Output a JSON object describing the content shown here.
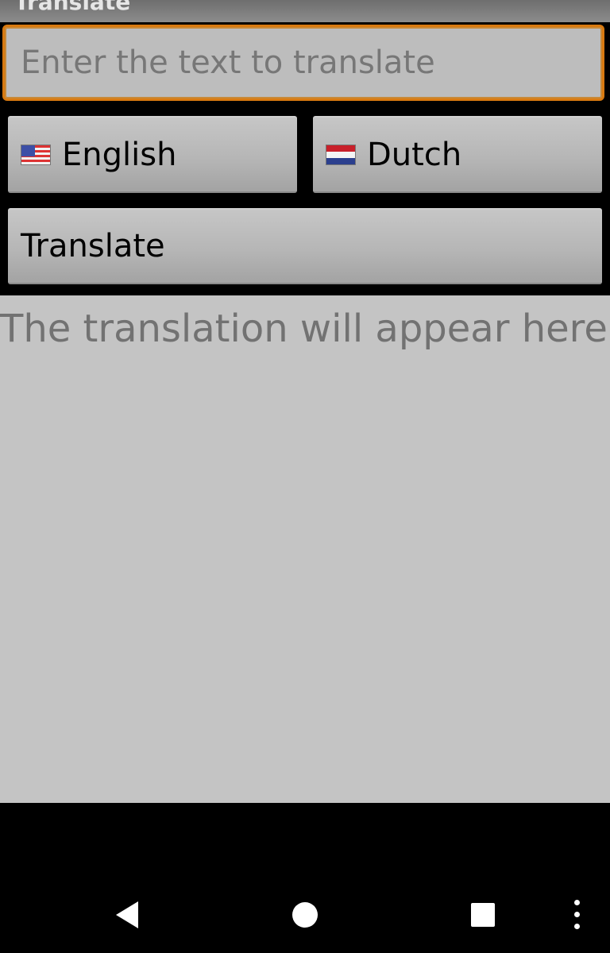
{
  "app": {
    "title": "Translate"
  },
  "input": {
    "placeholder": "Enter the text to translate",
    "value": ""
  },
  "languages": {
    "source": {
      "label": "English",
      "flag_icon": "us-flag-icon"
    },
    "target": {
      "label": "Dutch",
      "flag_icon": "netherlands-flag-icon"
    }
  },
  "actions": {
    "translate_label": "Translate"
  },
  "output": {
    "placeholder": "The translation will appear here"
  },
  "navbar": {
    "icons": [
      "back-icon",
      "home-icon",
      "recents-icon",
      "overflow-menu-icon"
    ]
  },
  "colors": {
    "focus_border": "#d97a10",
    "panel_bg": "#c4c4c4",
    "background": "#000000"
  }
}
